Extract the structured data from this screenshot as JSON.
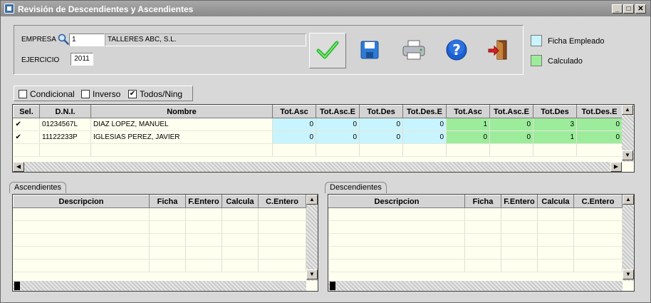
{
  "window": {
    "title": "Revisión de Descendientes y Ascendientes",
    "min": "_",
    "max": "□",
    "close": "✕"
  },
  "form": {
    "empresa_label": "EMPRESA",
    "empresa_code": "1",
    "empresa_name": "TALLERES ABC, S.L.",
    "ejercicio_label": "EJERCICIO",
    "ejercicio_value": "2011"
  },
  "toolbar": {
    "accept_icon": "check-icon",
    "save_icon": "save-icon",
    "print_icon": "printer-icon",
    "help_icon": "help-icon",
    "exit_icon": "exit-icon"
  },
  "legend": {
    "ficha_label": "Ficha Empleado",
    "ficha_color": "#c8f4ff",
    "calc_label": "Calculado",
    "calc_color": "#9cec9c"
  },
  "filters": {
    "condicional": {
      "label": "Condicional",
      "checked": false
    },
    "inverso": {
      "label": "Inverso",
      "checked": false
    },
    "todos": {
      "label": "Todos/Ning",
      "checked": true
    }
  },
  "main_grid": {
    "headers": [
      "Sel.",
      "D.N.I.",
      "Nombre",
      "Tot.Asc",
      "Tot.Asc.E",
      "Tot.Des",
      "Tot.Des.E",
      "Tot.Asc",
      "Tot.Asc.E",
      "Tot.Des",
      "Tot.Des.E"
    ],
    "rows": [
      {
        "sel": "✔",
        "dni": "01234567L",
        "nombre": "DIAZ  LOPEZ, MANUEL",
        "f1": "0",
        "f2": "0",
        "f3": "0",
        "f4": "0",
        "c1": "1",
        "c2": "0",
        "c3": "3",
        "c4": "0"
      },
      {
        "sel": "✔",
        "dni": "11122233P",
        "nombre": "IGLESIAS PEREZ, JAVIER",
        "f1": "0",
        "f2": "0",
        "f3": "0",
        "f4": "0",
        "c1": "0",
        "c2": "0",
        "c3": "1",
        "c4": "0"
      }
    ]
  },
  "ascendientes": {
    "tab": "Ascendientes",
    "headers": [
      "Descripcion",
      "Ficha",
      "F.Entero",
      "Calcula",
      "C.Entero"
    ]
  },
  "descendientes": {
    "tab": "Descendientes",
    "headers": [
      "Descripcion",
      "Ficha",
      "F.Entero",
      "Calcula",
      "C.Entero"
    ]
  },
  "scroll": {
    "up": "▲",
    "down": "▼",
    "left": "◀",
    "right": "▶"
  }
}
